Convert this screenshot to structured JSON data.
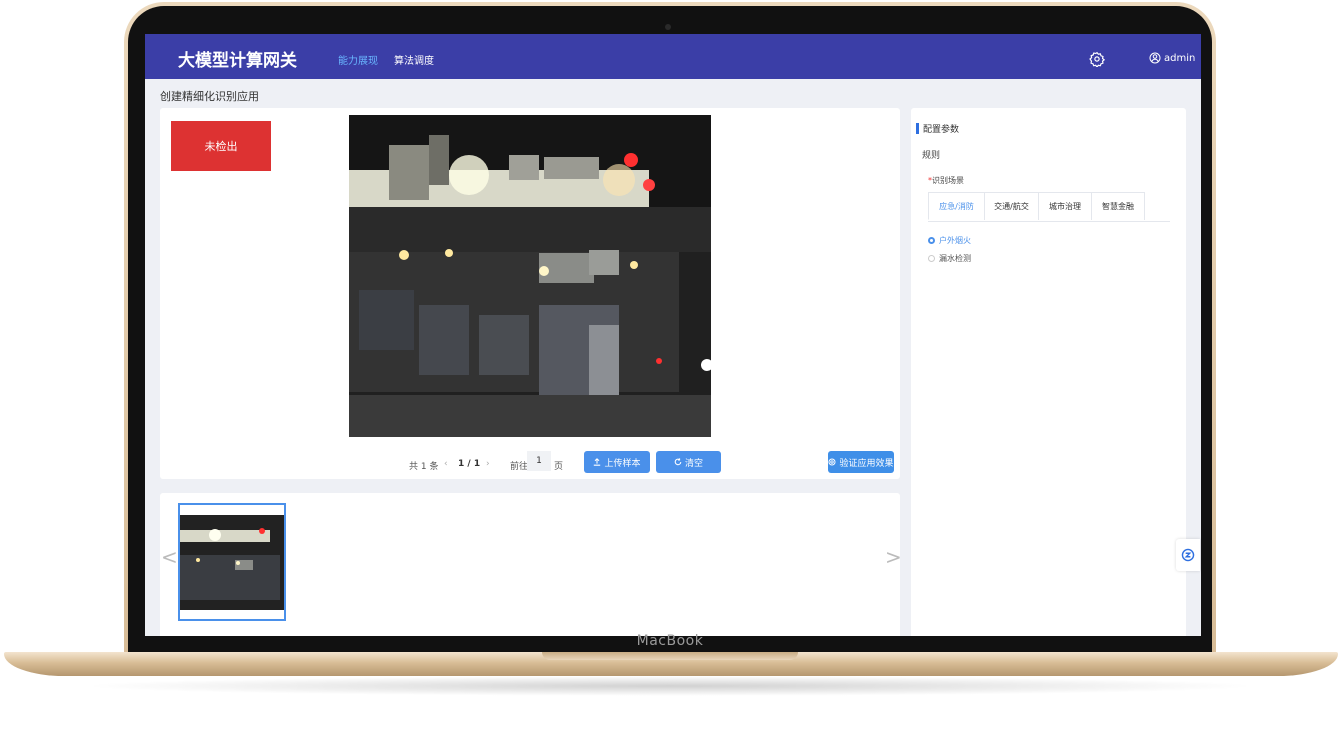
{
  "app": {
    "title": "大模型计算网关",
    "nav": [
      "能力展现",
      "算法调度"
    ],
    "user": "admin",
    "brand": "MacBook"
  },
  "page": {
    "title": "创建精细化识别应用"
  },
  "main": {
    "status": "未检出",
    "pager": {
      "total": "共 1 条",
      "prev": "‹",
      "current": "1 / 1",
      "next": "›",
      "goto": "前往",
      "page_input": "1",
      "page_suffix": "页"
    },
    "buttons": {
      "upload": "上传样本",
      "clear": "清空",
      "verify": "验证应用效果"
    }
  },
  "thumbs": {
    "prev": "<",
    "next": ">"
  },
  "side": {
    "title": "配置参数",
    "rule": "规则",
    "scene_required": "*",
    "scene_label": "识别场景",
    "tabs": [
      "应急/消防",
      "交通/航交",
      "城市治理",
      "智慧金融"
    ],
    "options": [
      "户外烟火",
      "漏水检测"
    ],
    "selected_option": "户外烟火"
  },
  "colors": {
    "header": "#3b3ea7",
    "accent": "#4a90ea",
    "status_red": "#dd3232"
  }
}
